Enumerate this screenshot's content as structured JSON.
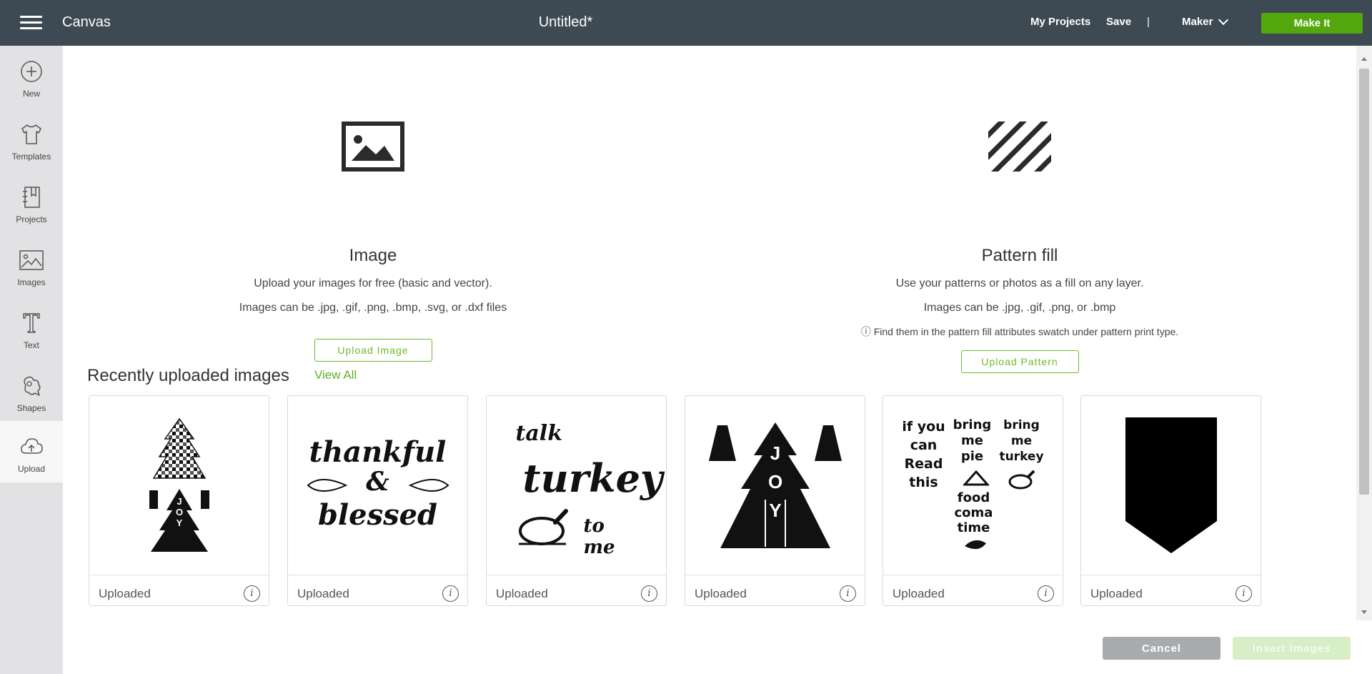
{
  "header": {
    "app_title": "Canvas",
    "doc_title": "Untitled*",
    "my_projects": "My Projects",
    "save": "Save",
    "separator": "|",
    "machine": "Maker",
    "make_it": "Make It"
  },
  "sidebar": {
    "items": [
      {
        "label": "New",
        "icon": "plus-circle-icon"
      },
      {
        "label": "Templates",
        "icon": "tshirt-icon"
      },
      {
        "label": "Projects",
        "icon": "notebook-icon"
      },
      {
        "label": "Images",
        "icon": "image-icon"
      },
      {
        "label": "Text",
        "icon": "text-icon"
      },
      {
        "label": "Shapes",
        "icon": "shapes-icon"
      },
      {
        "label": "Upload",
        "icon": "cloud-upload-icon",
        "active": true
      }
    ]
  },
  "image_upload": {
    "title": "Image",
    "line1": "Upload your images for free (basic and vector).",
    "line2": "Images can be .jpg, .gif, .png, .bmp, .svg, or .dxf files",
    "button": "Upload Image"
  },
  "pattern_upload": {
    "title": "Pattern fill",
    "line1": "Use your patterns or photos as a fill on any layer.",
    "line2": "Images can be .jpg, .gif, .png, or .bmp",
    "line3": "ⓘ Find them in the pattern fill attributes swatch under pattern print type.",
    "button": "Upload Pattern"
  },
  "recent": {
    "title": "Recently uploaded images",
    "view_all": "View All",
    "cards": [
      {
        "label": "Uploaded",
        "art": [
          "J",
          "O",
          "Y"
        ]
      },
      {
        "label": "Uploaded",
        "art": [
          "thankful",
          "&",
          "blessed"
        ]
      },
      {
        "label": "Uploaded",
        "art": [
          "talk",
          "turkey",
          "to me"
        ]
      },
      {
        "label": "Uploaded",
        "art": [
          "J",
          "O",
          "Y"
        ]
      },
      {
        "label": "Uploaded",
        "art": [
          "if you",
          "can",
          "Read",
          "this",
          "bring",
          "me",
          "pie",
          "bring",
          "me",
          "turkey",
          "food",
          "coma",
          "time"
        ]
      },
      {
        "label": "Uploaded"
      }
    ],
    "info_glyph": "i"
  },
  "footer": {
    "cancel": "Cancel",
    "insert": "Insert Images"
  },
  "colors": {
    "topbar": "#3e4a53",
    "accent_green": "#53a70c",
    "link_green": "#5fb21f"
  }
}
